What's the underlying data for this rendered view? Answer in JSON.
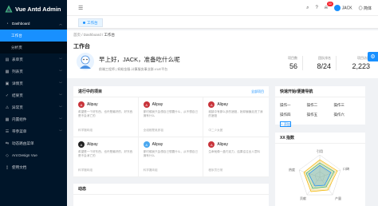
{
  "app": {
    "title": "Vue Antd Admin"
  },
  "sidebar": {
    "items": [
      {
        "label": "Dashboard",
        "icon": "dashboard-icon",
        "open": true,
        "children": [
          {
            "label": "工作台",
            "active": true
          },
          {
            "label": "分析页",
            "active": false
          }
        ]
      },
      {
        "label": "表单页",
        "icon": "form-icon"
      },
      {
        "label": "列表页",
        "icon": "table-icon"
      },
      {
        "label": "详情页",
        "icon": "profile-icon"
      },
      {
        "label": "结果页",
        "icon": "check-circle-icon"
      },
      {
        "label": "异常页",
        "icon": "warning-icon"
      },
      {
        "label": "内置组件",
        "icon": "appstore-icon"
      },
      {
        "label": "带参菜单",
        "icon": "menu-icon"
      },
      {
        "label": "动态路由菜单",
        "icon": "route-icon"
      },
      {
        "label": "Ant Design Vue",
        "icon": "ant-design-icon"
      },
      {
        "label": "使用文档",
        "icon": "file-icon"
      }
    ]
  },
  "header": {
    "notification_count": "10",
    "user_name": "JACK",
    "lang_label": "简体"
  },
  "tabs": [
    {
      "label": "工作台"
    }
  ],
  "page": {
    "breadcrumb": [
      "首页",
      "Dashboard",
      "工作台"
    ],
    "title": "工作台",
    "greeting": "早上好，JACK，准备吃什么呢",
    "subtitle": "前端工程师 | 蚂蚁金服-计算服务事业群-VUE平台",
    "stats": [
      {
        "label": "项目数",
        "value": "56"
      },
      {
        "label": "团队排名",
        "value": "8/24"
      },
      {
        "label": "项目访问",
        "value": "2,223"
      }
    ]
  },
  "projects": {
    "title": "进行中的项目",
    "extra": "全部项目",
    "items": [
      {
        "name": "Alipay",
        "icon": "red",
        "desc": "希望是一个好东西，也许是最好的，好东西是不会消亡的",
        "footer": "科学搬砖组"
      },
      {
        "name": "Alipay",
        "icon": "red",
        "desc": "那时候我只会想自己想要什么，从不想自己拥有什么",
        "footer": "全组都是吴彦祖"
      },
      {
        "name": "Alipay",
        "icon": "red",
        "desc": "城镇中有那么多的酒馆，她却偏偏走进了我的酒馆",
        "footer": "中二少女团"
      },
      {
        "name": "Alipay",
        "icon": "dark",
        "desc": "希望是一个好东西，也许是最好的，好东西是不会消亡的",
        "footer": "科学搬砖组"
      },
      {
        "name": "Alipay",
        "icon": "blue",
        "desc": "那时候我只会想自己想要什么，从不想自己拥有什么",
        "footer": "科学搬砖组"
      },
      {
        "name": "Alipay",
        "icon": "red",
        "desc": "生命就像一盒巧克力，结果往往出人意料",
        "footer": "程序员日常"
      }
    ]
  },
  "quick_nav": {
    "title": "快速开始/便捷导航",
    "items": [
      "操作一",
      "操作二",
      "操作三",
      "操作四",
      "操作五",
      "操作六"
    ],
    "add_label": "+ 添加"
  },
  "activity": {
    "title": "动态"
  },
  "radar": {
    "title": "XX 指数",
    "labels": [
      "引用",
      "口碑",
      "产量",
      "贡献",
      "热度"
    ]
  }
}
